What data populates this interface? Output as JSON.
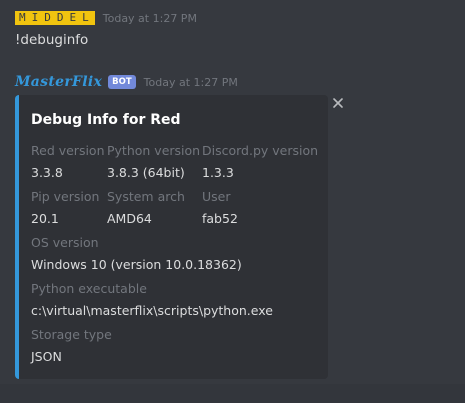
{
  "messages": [
    {
      "author": "MIDDEL",
      "timestamp": "Today at 1:27 PM",
      "content": "!debuginfo",
      "badge_color": "#f1c40f"
    },
    {
      "author": "MasterFlix",
      "bot_tag": "BOT",
      "timestamp": "Today at 1:27 PM",
      "author_color": "#3498db"
    }
  ],
  "embed": {
    "title": "Debug Info for Red",
    "accent_color": "#3498db",
    "fields": [
      {
        "name": "Red version",
        "value": "3.3.8"
      },
      {
        "name": "Python version",
        "value": "3.8.3 (64bit)"
      },
      {
        "name": "Discord.py version",
        "value": "1.3.3"
      },
      {
        "name": "Pip version",
        "value": "20.1"
      },
      {
        "name": "System arch",
        "value": "AMD64"
      },
      {
        "name": "User",
        "value": "fab52"
      },
      {
        "name": "OS version",
        "value": "Windows 10 (version 10.0.18362)"
      },
      {
        "name": "Python executable",
        "value": "c:\\virtual\\masterflix\\scripts\\python.exe"
      },
      {
        "name": "Storage type",
        "value": "JSON"
      }
    ]
  },
  "icons": {
    "close": "close-icon"
  }
}
